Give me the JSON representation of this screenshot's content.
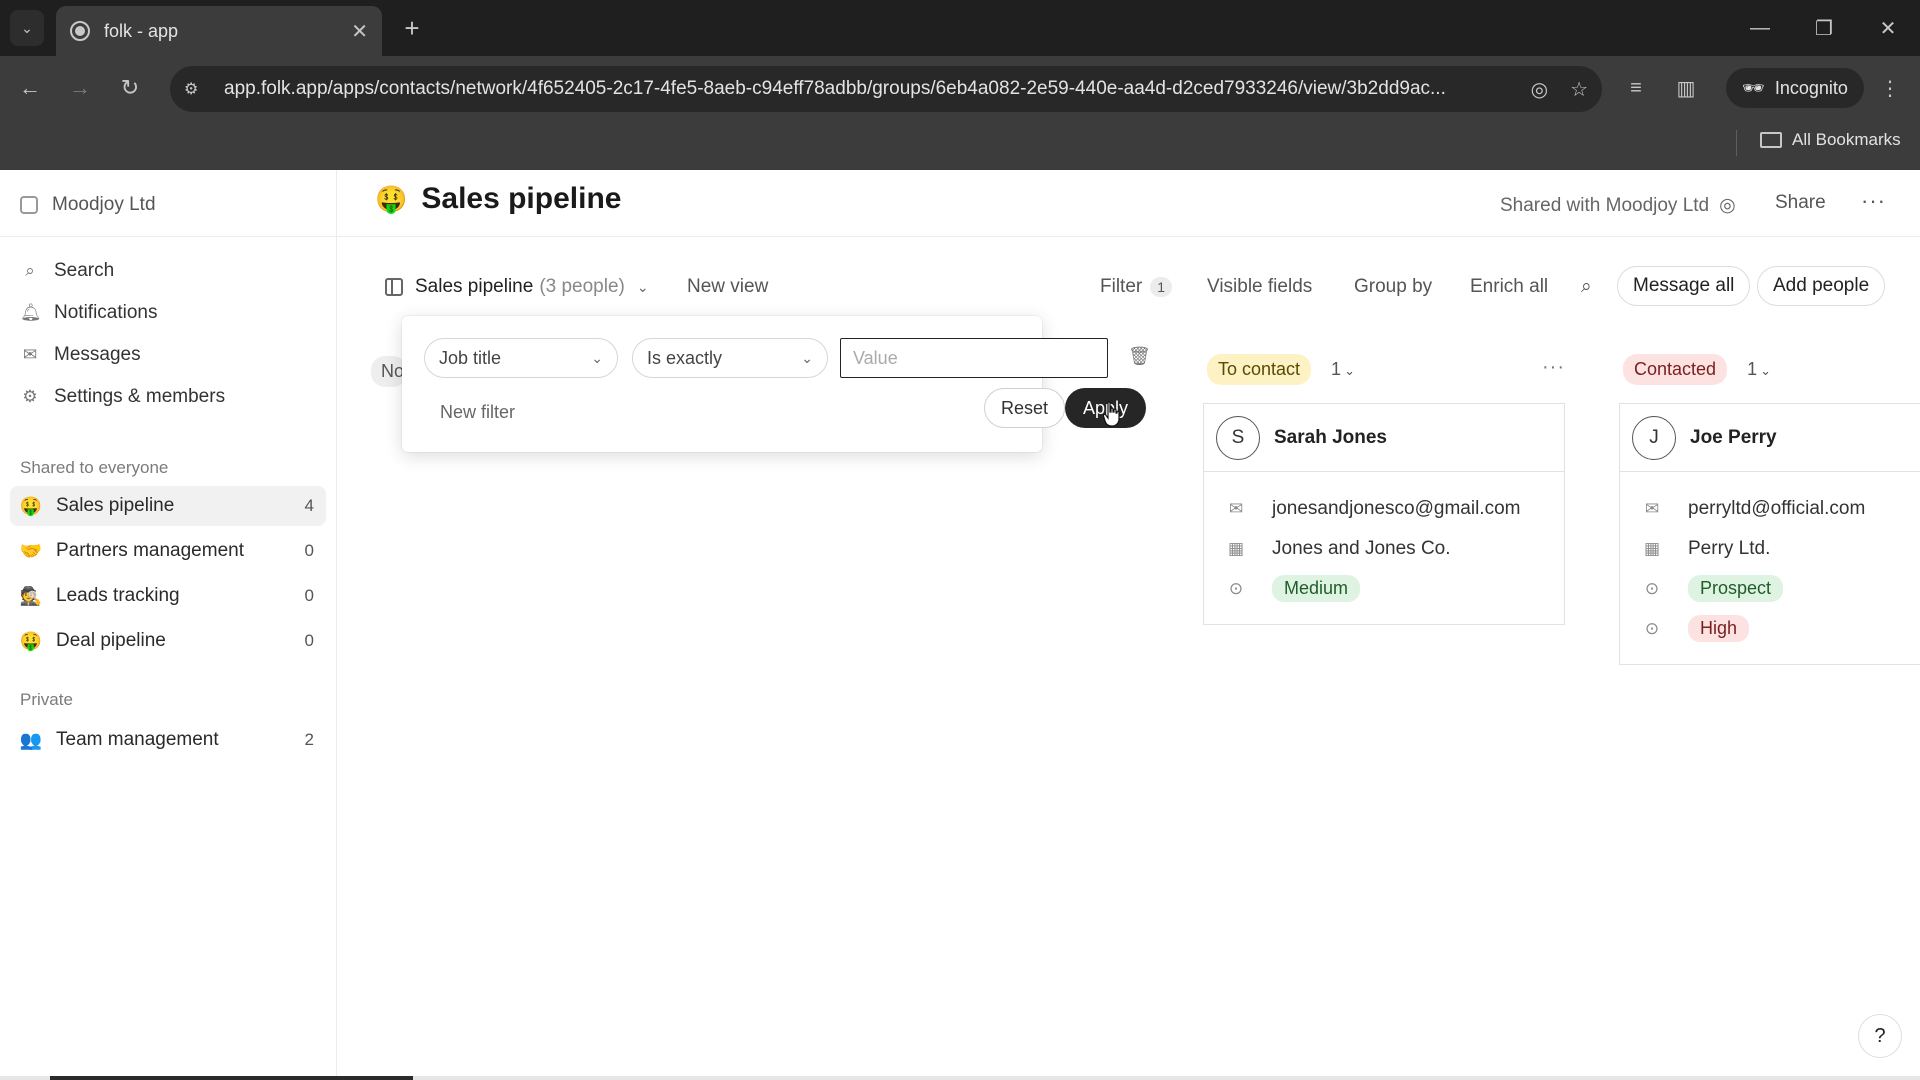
{
  "browser": {
    "tab_title": "folk - app",
    "url": "app.folk.app/apps/contacts/network/4f652405-2c17-4fe5-8aeb-c94eff78adbb/groups/6eb4a082-2e59-440e-aa4d-d2ced7933246/view/3b2dd9ac...",
    "incognito_label": "Incognito",
    "all_bookmarks_label": "All Bookmarks"
  },
  "sidebar": {
    "workspace_name": "Moodjoy Ltd",
    "links": [
      {
        "label": "Search",
        "icon": "search-icon"
      },
      {
        "label": "Notifications",
        "icon": "bell-icon"
      },
      {
        "label": "Messages",
        "icon": "mail-icon"
      },
      {
        "label": "Settings & members",
        "icon": "gear-icon"
      }
    ],
    "shared_label": "Shared to everyone",
    "shared_groups": [
      {
        "emoji": "🤑",
        "label": "Sales pipeline",
        "count": "4"
      },
      {
        "emoji": "🤝",
        "label": "Partners management",
        "count": "0"
      },
      {
        "emoji": "🕵",
        "label": "Leads tracking",
        "count": "0"
      },
      {
        "emoji": "🤑",
        "label": "Deal pipeline",
        "count": "0"
      }
    ],
    "private_label": "Private",
    "private_groups": [
      {
        "emoji": "👥",
        "label": "Team management",
        "count": "2"
      }
    ]
  },
  "header": {
    "emoji": "🤑",
    "title": "Sales pipeline",
    "shared_with": "Shared with Moodjoy Ltd",
    "share_label": "Share",
    "more_label": "···"
  },
  "viewbar": {
    "view_name": "Sales pipeline",
    "view_count": "(3 people)",
    "new_view": "New view",
    "filter": "Filter",
    "filter_count": "1",
    "visible_fields": "Visible fields",
    "group_by": "Group by",
    "enrich_all": "Enrich all",
    "message_all": "Message all",
    "add_people": "Add people"
  },
  "filter_popover": {
    "field": "Job title",
    "operator": "Is exactly",
    "value": "",
    "value_placeholder": "Value",
    "new_filter": "New filter",
    "reset": "Reset",
    "apply": "Apply"
  },
  "board": {
    "hidden_column_label": "No",
    "columns": [
      {
        "label": "To contact",
        "count": "1",
        "cards": [
          {
            "initial": "S",
            "name": "Sarah Jones",
            "email": "jonesandjonesco@gmail.com",
            "company": "Jones and Jones Co.",
            "tags": [
              "Medium"
            ]
          }
        ]
      },
      {
        "label": "Contacted",
        "count": "1",
        "cards": [
          {
            "initial": "J",
            "name": "Joe Perry",
            "email": "perryltd@official.com",
            "company": "Perry Ltd.",
            "tags": [
              "Prospect",
              "High"
            ]
          }
        ]
      }
    ]
  },
  "help_label": "?"
}
